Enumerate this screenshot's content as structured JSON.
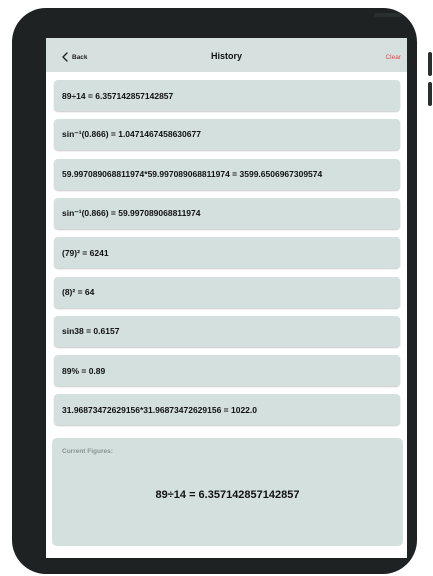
{
  "header": {
    "back_label": "Back",
    "title": "History",
    "clear_label": "Clear"
  },
  "history": [
    "89÷14 = 6.357142857142857",
    "sin⁻¹(0.866) = 1.0471467458630677",
    "59.997089068811974*59.997089068811974 = 3599.6506967309574",
    "sin⁻¹(0.866) = 59.997089068811974",
    "(79)² = 6241",
    "(8)² = 64",
    "sin38 = 0.6157",
    "89% = 0.89",
    "31.96873472629156*31.96873472629156 = 1022.0"
  ],
  "current": {
    "label": "Current Figures:",
    "value": "89÷14 = 6.357142857142857"
  },
  "colors": {
    "accent_clear": "#e54848",
    "panel": "#d3e0de",
    "device_frame": "#1e2222"
  }
}
